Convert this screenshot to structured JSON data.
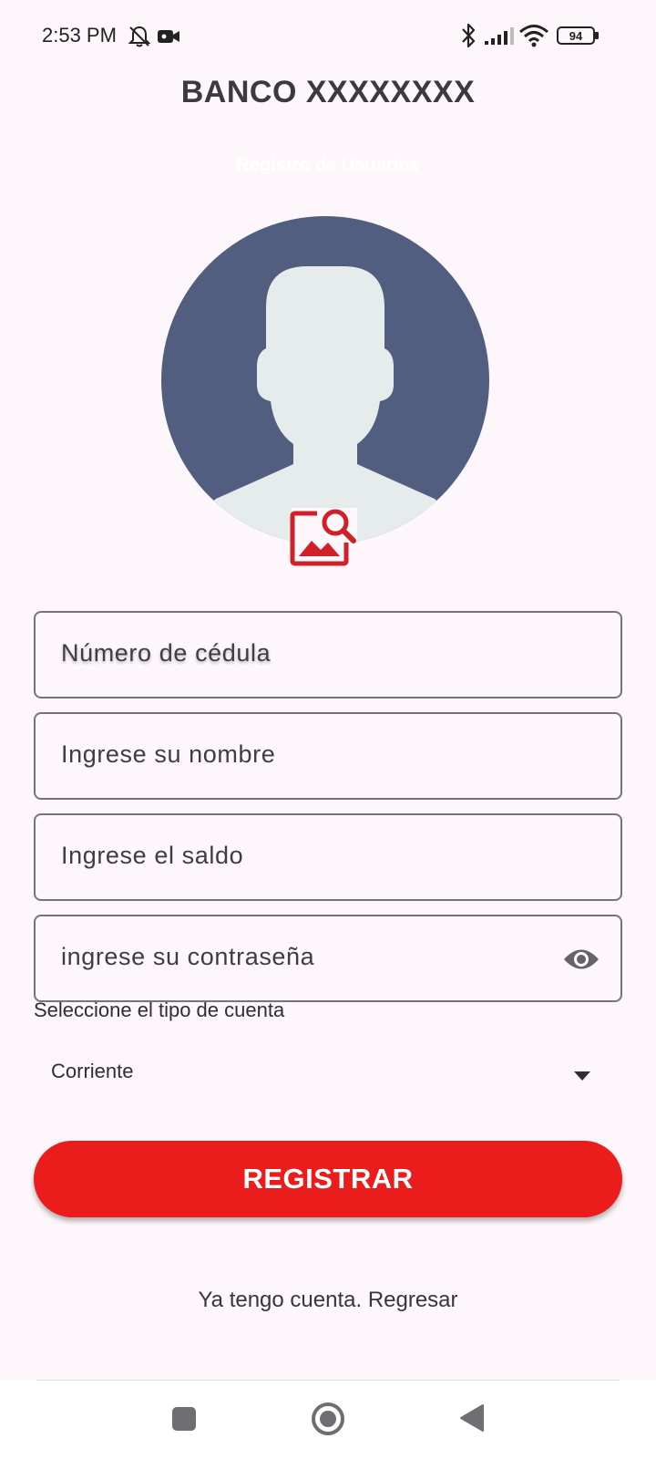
{
  "status_bar": {
    "time": "2:53 PM",
    "icons": [
      "bell-off-icon",
      "video-camera-icon",
      "bluetooth-icon",
      "signal-icon",
      "wifi-icon",
      "battery-icon"
    ],
    "battery_level": "94"
  },
  "header": {
    "title": "BANCO XXXXXXXX",
    "subtitle": "Registro de Usuarios"
  },
  "avatar": {
    "icon": "person-avatar-icon",
    "colors": {
      "background": "#525e80",
      "silhouette": "#e6ebeb"
    }
  },
  "photo_picker": {
    "icon": "image-search-icon",
    "color": "#d12128"
  },
  "form": {
    "cedula_placeholder": "Número de cédula",
    "name_placeholder": "Ingrese su nombre",
    "balance_placeholder": "Ingrese el saldo",
    "password_placeholder": "ingrese su contraseña",
    "password_toggle_icon": "eye-icon",
    "account_type_label": "Seleccione el tipo de cuenta",
    "account_type_value": "Corriente"
  },
  "actions": {
    "register_label": "REGISTRAR",
    "back_link": "Ya tengo cuenta. Regresar"
  },
  "nav_bar": {
    "icons": [
      "recents-square-icon",
      "home-circle-icon",
      "back-triangle-icon"
    ]
  },
  "colors": {
    "background": "#fdf7fc",
    "accent": "#ea1c1c",
    "field_border": "#77737b"
  }
}
